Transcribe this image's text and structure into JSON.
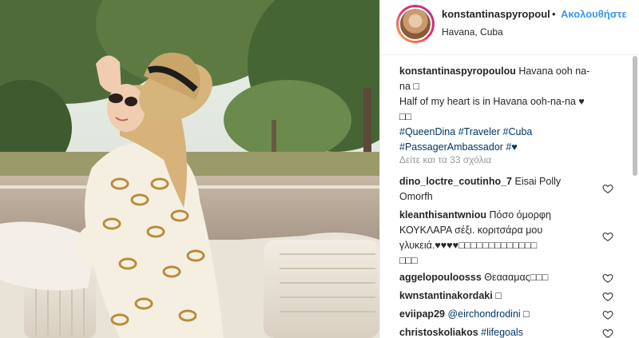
{
  "post": {
    "username": "konstantinaspyropoul",
    "separator": "•",
    "follow_label": "Ακολουθήστε",
    "location": "Havana, Cuba"
  },
  "caption": {
    "username": "konstantinaspyropoulou",
    "line1": "Havana ooh na-",
    "line2": "na □",
    "line3": "Half of my heart is in Havana ooh-na-na ♥",
    "line4": "□□",
    "hashtags": [
      "#QueenDina",
      "#Traveler",
      "#Cuba",
      "#PassagerAmbassador",
      "#♥"
    ]
  },
  "view_more": "Δείτε και τα 33 σχόλια",
  "comments": [
    {
      "user": "dino_loctre_coutinho_7",
      "text": "Eisai Polly",
      "text2": "Omorfh"
    },
    {
      "user": "kleanthisantwniou",
      "text": "Πόσο όμορφη",
      "text2": "ΚΟΥΚΛΑΡΑ σέξι. κοριτσάρα μου",
      "text3": "γλυκειά.♥♥♥♥□□□□□□□□□□□□□",
      "text4": "□□□"
    },
    {
      "user": "aggelopouloosss",
      "text": "Θεαααμας□□□"
    },
    {
      "user": "kwnstantinakordaki",
      "text": "□"
    },
    {
      "user": "eviipap29",
      "mention": "@eirchondrodini",
      "text": "□"
    },
    {
      "user": "christoskoliakos",
      "mention": "#lifegoals"
    }
  ],
  "colors": {
    "link": "#003569",
    "follow": "#3897f0",
    "muted": "#999999",
    "text": "#262626"
  },
  "icons": {
    "avatar": "profile-photo",
    "heart": "heart-outline-icon",
    "photo": "woman-in-hat-in-convertible-photo"
  }
}
